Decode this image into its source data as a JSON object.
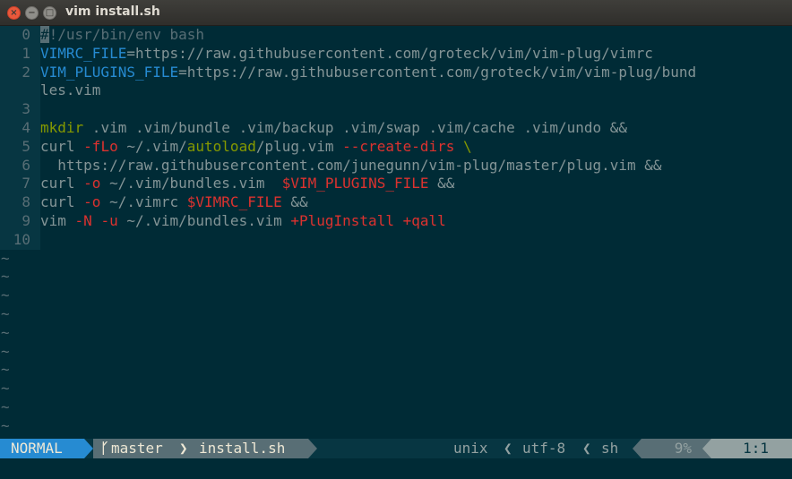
{
  "window": {
    "title": "vim install.sh",
    "close_glyph": "×",
    "minimize_glyph": "−",
    "maximize_glyph": "□"
  },
  "editor": {
    "lines": [
      {
        "num": "0",
        "tokens": [
          {
            "t": "#",
            "c": "cursor"
          },
          {
            "t": "!/usr/bin/env bash",
            "c": "comment"
          }
        ]
      },
      {
        "num": "1",
        "tokens": [
          {
            "t": "VIMRC_FILE",
            "c": "var"
          },
          {
            "t": "=https://raw.githubusercontent.com/groteck/vim/vim-plug/vimrc",
            "c": "plain"
          }
        ]
      },
      {
        "num": "2",
        "tokens": [
          {
            "t": "VIM_PLUGINS_FILE",
            "c": "var"
          },
          {
            "t": "=https://raw.githubusercontent.com/groteck/vim/vim-plug/bund",
            "c": "plain"
          }
        ]
      },
      {
        "num": "",
        "tokens": [
          {
            "t": "les.vim",
            "c": "plain"
          }
        ]
      },
      {
        "num": "3",
        "tokens": []
      },
      {
        "num": "4",
        "tokens": [
          {
            "t": "mkdir",
            "c": "kw"
          },
          {
            "t": " .vim .vim/bundle .vim/backup .vim/swap .vim/cache .vim/undo &&",
            "c": "plain"
          }
        ]
      },
      {
        "num": "5",
        "tokens": [
          {
            "t": "curl ",
            "c": "plain"
          },
          {
            "t": "-fLo",
            "c": "opt"
          },
          {
            "t": " ~/.vim/",
            "c": "plain"
          },
          {
            "t": "autoload",
            "c": "kw"
          },
          {
            "t": "/plug.vim ",
            "c": "plain"
          },
          {
            "t": "--create-dirs",
            "c": "opt"
          },
          {
            "t": " \\",
            "c": "kw"
          }
        ]
      },
      {
        "num": "6",
        "tokens": [
          {
            "t": "  https://raw.githubusercontent.com/junegunn/vim-plug/master/plug.vim &&",
            "c": "plain"
          }
        ]
      },
      {
        "num": "7",
        "tokens": [
          {
            "t": "curl ",
            "c": "plain"
          },
          {
            "t": "-o",
            "c": "opt"
          },
          {
            "t": " ~/.vim/bundles.vim  ",
            "c": "plain"
          },
          {
            "t": "$VIM_PLUGINS_FILE",
            "c": "opt"
          },
          {
            "t": " &&",
            "c": "plain"
          }
        ]
      },
      {
        "num": "8",
        "tokens": [
          {
            "t": "curl ",
            "c": "plain"
          },
          {
            "t": "-o",
            "c": "opt"
          },
          {
            "t": " ~/.vimrc ",
            "c": "plain"
          },
          {
            "t": "$VIMRC_FILE",
            "c": "opt"
          },
          {
            "t": " &&",
            "c": "plain"
          }
        ]
      },
      {
        "num": "9",
        "tokens": [
          {
            "t": "vim ",
            "c": "plain"
          },
          {
            "t": "-N",
            "c": "opt"
          },
          {
            "t": " ",
            "c": "plain"
          },
          {
            "t": "-u",
            "c": "opt"
          },
          {
            "t": " ~/.vim/bundles.vim ",
            "c": "plain"
          },
          {
            "t": "+PlugInstall",
            "c": "opt"
          },
          {
            "t": " ",
            "c": "plain"
          },
          {
            "t": "+qall",
            "c": "opt"
          }
        ]
      },
      {
        "num": "10",
        "tokens": []
      }
    ],
    "tilde_rows": [
      "~",
      "~",
      "~",
      "~",
      "~",
      "~",
      "~",
      "~",
      "~",
      "~"
    ],
    "colors": {
      "background": "#002b36",
      "gutter_bg": "#073642",
      "variable": "#268bd2",
      "keyword": "#859900",
      "option": "#dc322f",
      "comment": "#586e75",
      "plain": "#839496"
    }
  },
  "statusline": {
    "mode": "NORMAL",
    "branch_icon": "ᚴ",
    "branch": "master",
    "filename": "install.sh",
    "fileformat": "unix",
    "encoding": "utf-8",
    "filetype": "sh",
    "percent": "9%",
    "position": "1:1",
    "separator_left": "❯",
    "separator_right": "❮"
  }
}
